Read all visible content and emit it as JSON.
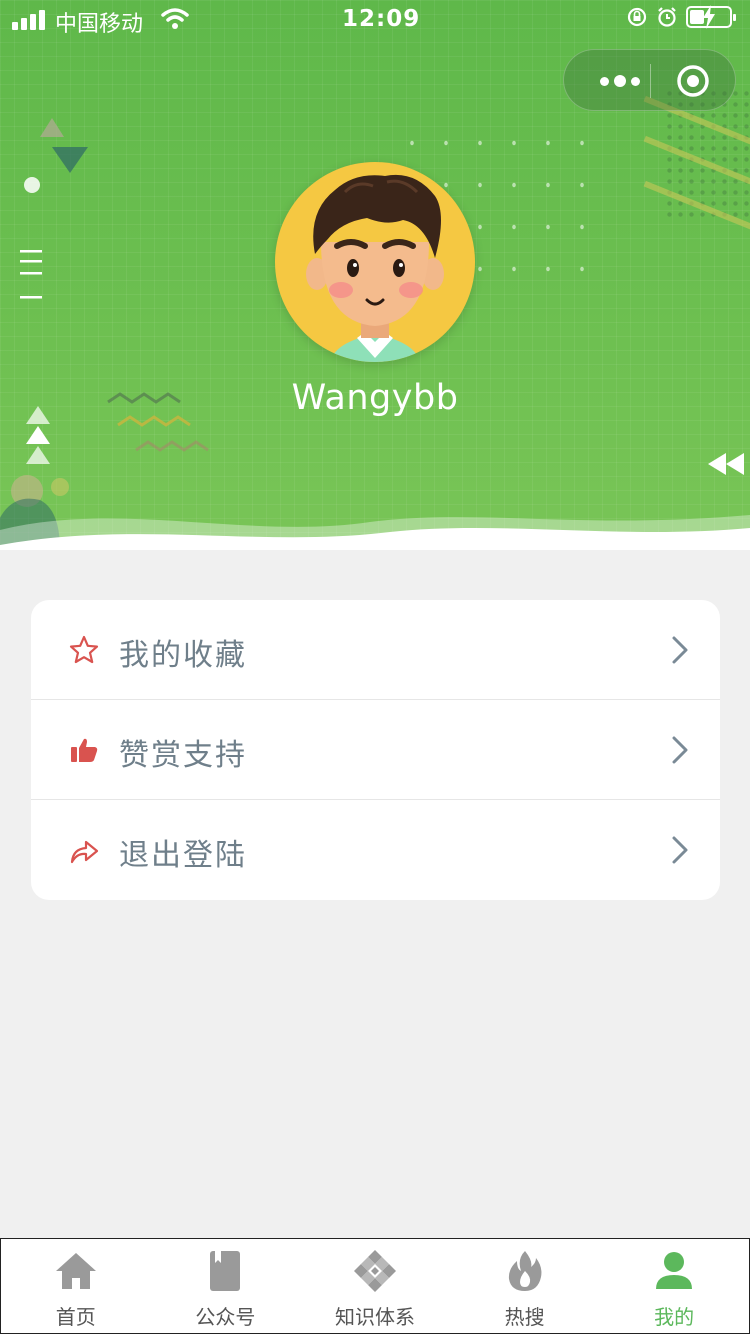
{
  "status_bar": {
    "carrier": "中国移动",
    "time": "12:09",
    "battery_level": 0.3
  },
  "capsule": {
    "more_icon": "more-dots-icon",
    "close_icon": "target-icon"
  },
  "profile": {
    "username": "Wangybb",
    "avatar_icon": "cartoon-avatar"
  },
  "menu": {
    "items": [
      {
        "label": "我的收藏",
        "icon": "star-icon",
        "color": "#d9534f"
      },
      {
        "label": "赞赏支持",
        "icon": "thumbs-up-icon",
        "color": "#d9534f"
      },
      {
        "label": "退出登陆",
        "icon": "share-arrow-icon",
        "color": "#d9534f"
      }
    ]
  },
  "tabbar": {
    "active_color": "#5cb85c",
    "inactive_color": "#9a9a9a",
    "tabs": [
      {
        "label": "首页",
        "icon": "home-icon"
      },
      {
        "label": "公众号",
        "icon": "book-icon"
      },
      {
        "label": "知识体系",
        "icon": "diamond-grid-icon"
      },
      {
        "label": "热搜",
        "icon": "flame-icon"
      },
      {
        "label": "我的",
        "icon": "person-icon"
      }
    ]
  },
  "colors": {
    "header_green": "#6cbf50",
    "page_bg": "#f0f0f0",
    "label_gray": "#6f7f8a"
  }
}
